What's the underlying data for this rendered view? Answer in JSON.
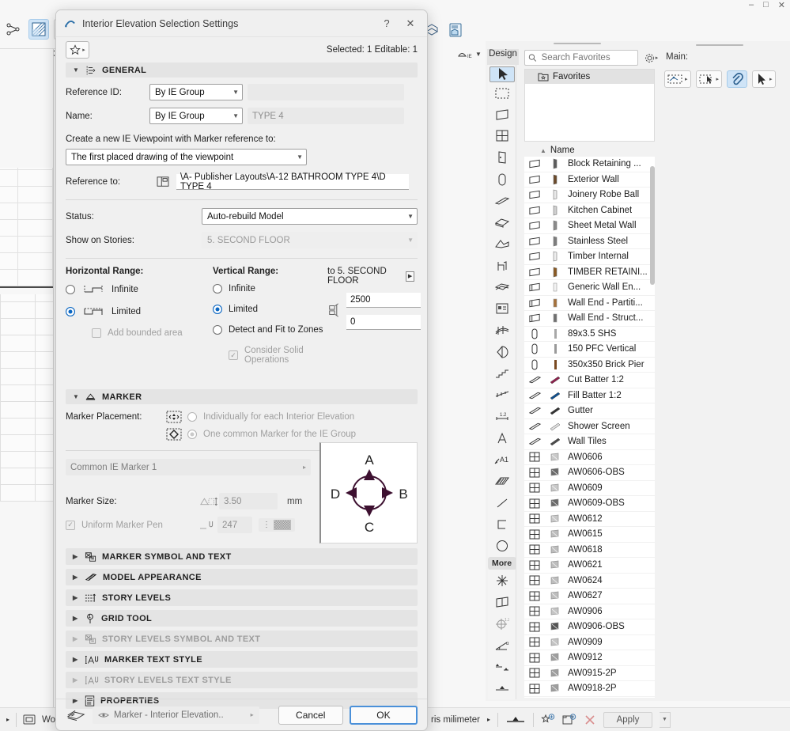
{
  "dialog": {
    "title": "Interior Elevation Selection Settings",
    "help_label": "?",
    "close_label": "✕",
    "selection_info": "Selected: 1 Editable: 1",
    "favorites_caret": "▸",
    "sections": {
      "general": "GENERAL",
      "marker": "MARKER",
      "marker_symbol_and_text": "MARKER SYMBOL AND TEXT",
      "model_appearance": "MODEL APPEARANCE",
      "story_levels": "STORY LEVELS",
      "grid_tool": "GRID TOOL",
      "story_levels_symbol_and_text": "STORY LEVELS SYMBOL AND TEXT",
      "marker_text_style": "MARKER TEXT STYLE",
      "story_levels_text_style": "STORY LEVELS TEXT STYLE",
      "properties": "PROPERTIES"
    },
    "general": {
      "reference_id_label": "Reference ID:",
      "reference_id_value": "By IE Group",
      "name_label": "Name:",
      "name_value": "By IE Group",
      "name_text": "TYPE 4",
      "create_hint": "Create a new IE Viewpoint with Marker reference to:",
      "create_value": "The first placed drawing of the viewpoint",
      "reference_to_label": "Reference to:",
      "reference_to_value": "\\A- Publisher Layouts\\A-12 BATHROOM TYPE 4\\D TYPE 4",
      "status_label": "Status:",
      "status_value": "Auto-rebuild Model",
      "show_on_stories_label": "Show on Stories:",
      "show_on_stories_value": "5. SECOND FLOOR",
      "horizontal_range_label": "Horizontal Range:",
      "horizontal_infinite": "Infinite",
      "horizontal_limited": "Limited",
      "add_bounded_area": "Add bounded area",
      "vertical_range_label": "Vertical Range:",
      "vertical_infinite": "Infinite",
      "vertical_limited": "Limited",
      "detect_and_fit": "Detect and Fit to Zones",
      "consider_solid_operations": "Consider Solid Operations",
      "story_ref": "to 5. SECOND FLOOR",
      "height_top": "2500",
      "height_bottom": "0"
    },
    "marker": {
      "placement_label": "Marker Placement:",
      "placement_individual": "Individually for each Interior Elevation",
      "placement_common": "One common Marker for the IE Group",
      "marker_object": "Common IE Marker 1",
      "marker_size_label": "Marker Size:",
      "marker_size_value": "3.50",
      "marker_size_unit": "mm",
      "uniform_marker_pen": "Uniform Marker Pen",
      "pen_number": "247",
      "preview_labels": {
        "a": "A",
        "b": "B",
        "c": "C",
        "d": "D"
      }
    },
    "footer": {
      "layer_value": "Marker - Interior Elevation..",
      "layer_caret": "▸",
      "cancel_label": "Cancel",
      "ok_label": "OK"
    }
  },
  "favorites_panel": {
    "tab_label": "Design",
    "search_placeholder": "Search Favorites",
    "folder_label": "Favorites",
    "column_name": "Name",
    "sort_arrow": "▲",
    "items": [
      {
        "type": "wall",
        "name": "Block Retaining ...",
        "swatch": "#5c5c5c"
      },
      {
        "type": "wall",
        "name": "Exterior Wall",
        "swatch": "#6b4a2a"
      },
      {
        "type": "wall",
        "name": "Joinery Robe Ball",
        "swatch": "#e8e8e8"
      },
      {
        "type": "wall",
        "name": "Kitchen Cabinet",
        "swatch": "#cfcfcf"
      },
      {
        "type": "wall",
        "name": "Sheet Metal Wall",
        "swatch": "#8a8a8a"
      },
      {
        "type": "wall",
        "name": "Stainless Steel",
        "swatch": "#7d7d7d"
      },
      {
        "type": "wall",
        "name": "Timber Internal",
        "swatch": "#ededed"
      },
      {
        "type": "wall",
        "name": "TIMBER RETAINI...",
        "swatch": "#8a5a22"
      },
      {
        "type": "wallend",
        "name": "Generic Wall En...",
        "swatch": "#f2f2f2"
      },
      {
        "type": "wallend",
        "name": "Wall End - Partiti...",
        "swatch": "#a5703a"
      },
      {
        "type": "wallend",
        "name": "Wall End - Struct...",
        "swatch": "#6f6f6f"
      },
      {
        "type": "column",
        "name": "89x3.5 SHS",
        "swatch": "#a8a8a8"
      },
      {
        "type": "column",
        "name": "150 PFC Vertical",
        "swatch": "#9a9a9a"
      },
      {
        "type": "column",
        "name": "350x350 Brick Pier",
        "swatch": "#7a4a22"
      },
      {
        "type": "beam",
        "name": "Cut Batter 1:2",
        "swatch": "#8e1f4c"
      },
      {
        "type": "beam",
        "name": "Fill Batter 1:2",
        "swatch": "#0f4f8e"
      },
      {
        "type": "beam",
        "name": "Gutter",
        "swatch": "#333333"
      },
      {
        "type": "beam",
        "name": "Shower Screen",
        "swatch": "#dfdfdf"
      },
      {
        "type": "beam",
        "name": "Wall Tiles",
        "swatch": "#4a4a4a"
      },
      {
        "type": "window",
        "name": "AW0606",
        "swatch": "#c9c9c9"
      },
      {
        "type": "window",
        "name": "AW0606-OBS",
        "swatch": "#6a6a6a"
      },
      {
        "type": "window",
        "name": "AW0609",
        "swatch": "#c9c9c9"
      },
      {
        "type": "window",
        "name": "AW0609-OBS",
        "swatch": "#6a6a6a"
      },
      {
        "type": "window",
        "name": "AW0612",
        "swatch": "#c9c9c9"
      },
      {
        "type": "window",
        "name": "AW0615",
        "swatch": "#bdbdbd"
      },
      {
        "type": "window",
        "name": "AW0618",
        "swatch": "#bdbdbd"
      },
      {
        "type": "window",
        "name": "AW0621",
        "swatch": "#bdbdbd"
      },
      {
        "type": "window",
        "name": "AW0624",
        "swatch": "#bdbdbd"
      },
      {
        "type": "window",
        "name": "AW0627",
        "swatch": "#bdbdbd"
      },
      {
        "type": "window",
        "name": "AW0906",
        "swatch": "#c4c4c4"
      },
      {
        "type": "window",
        "name": "AW0906-OBS",
        "swatch": "#555555"
      },
      {
        "type": "window",
        "name": "AW0909",
        "swatch": "#c4c4c4"
      },
      {
        "type": "window",
        "name": "AW0912",
        "swatch": "#9e9e9e"
      },
      {
        "type": "window",
        "name": "AW0915-2P",
        "swatch": "#9e9e9e"
      },
      {
        "type": "window",
        "name": "AW0918-2P",
        "swatch": "#9e9e9e"
      }
    ]
  },
  "main_toolbar": {
    "label": "Main:"
  },
  "statusbar": {
    "unit_text": "ris milimeter",
    "unit_caret": "▸",
    "apply_label": "Apply",
    "wo_label": "Wo",
    "caret": "▸"
  }
}
